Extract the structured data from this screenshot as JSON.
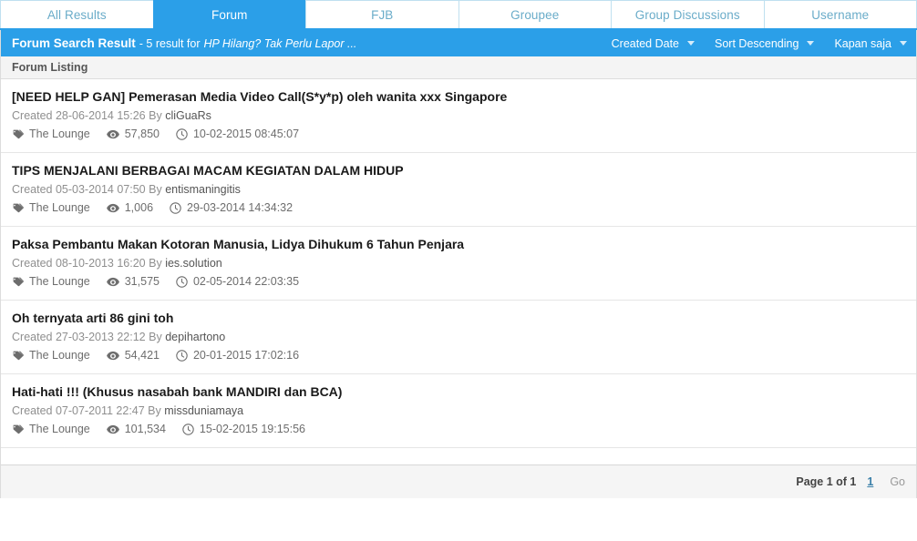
{
  "tabs": [
    {
      "label": "All Results",
      "active": false
    },
    {
      "label": "Forum",
      "active": true
    },
    {
      "label": "FJB",
      "active": false
    },
    {
      "label": "Groupee",
      "active": false
    },
    {
      "label": "Group Discussions",
      "active": false
    },
    {
      "label": "Username",
      "active": false
    }
  ],
  "result_header": {
    "title": "Forum Search Result",
    "summary": "- 5 result for",
    "query": "HP Hilang? Tak Perlu Lapor ...",
    "sort_controls": [
      {
        "label": "Created Date",
        "icon": "chevron-down-icon"
      },
      {
        "label": "Sort Descending",
        "icon": "chevron-down-icon"
      },
      {
        "label": "Kapan saja",
        "icon": "chevron-down-icon"
      }
    ]
  },
  "sub_header": {
    "label": "Forum Listing"
  },
  "results": [
    {
      "title": "[NEED HELP GAN] Pemerasan Media Video Call(S*y*p) oleh wanita xxx Singapore",
      "created_prefix": "Created 28-06-2014 15:26 By",
      "author": "cliGuaRs",
      "forum": "The Lounge",
      "views": "57,850",
      "last_post": "10-02-2015 08:45:07"
    },
    {
      "title": "TIPS MENJALANI BERBAGAI MACAM KEGIATAN DALAM HIDUP",
      "created_prefix": "Created 05-03-2014 07:50 By",
      "author": "entismaningitis",
      "forum": "The Lounge",
      "views": "1,006",
      "last_post": "29-03-2014 14:34:32"
    },
    {
      "title": "Paksa Pembantu Makan Kotoran Manusia, Lidya Dihukum 6 Tahun Penjara",
      "created_prefix": "Created 08-10-2013 16:20 By",
      "author": "ies.solution",
      "forum": "The Lounge",
      "views": "31,575",
      "last_post": "02-05-2014 22:03:35"
    },
    {
      "title": "Oh ternyata arti 86 gini toh",
      "created_prefix": "Created 27-03-2013 22:12 By",
      "author": "depihartono",
      "forum": "The Lounge",
      "views": "54,421",
      "last_post": "20-01-2015 17:02:16"
    },
    {
      "title": "Hati-hati !!! (Khusus nasabah bank MANDIRI dan BCA)",
      "created_prefix": "Created 07-07-2011 22:47 By",
      "author": "missduniamaya",
      "forum": "The Lounge",
      "views": "101,534",
      "last_post": "15-02-2015 19:15:56"
    }
  ],
  "footer": {
    "page_info": "Page 1 of 1",
    "current_page": "1",
    "go_label": "Go"
  },
  "colors": {
    "accent_blue": "#2b9fe8",
    "tab_text": "#6aacc9",
    "link_blue": "#3a7fa8"
  },
  "icons": {
    "tag": "tag-icon",
    "views": "eye-icon",
    "time": "clock-icon"
  }
}
